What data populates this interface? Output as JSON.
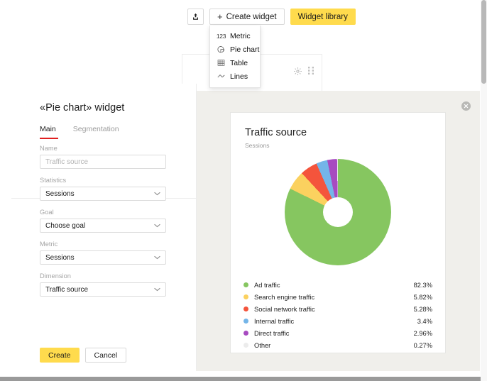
{
  "toolbar": {
    "export_icon": "upload-icon",
    "create_widget_label": "Create widget",
    "create_widget_plus": "+",
    "widget_library_label": "Widget library",
    "accent_yellow": "#ffdb4d"
  },
  "dropdown": {
    "items": [
      {
        "label": "Metric",
        "icon": "number-123-icon",
        "glyph": "123"
      },
      {
        "label": "Pie chart",
        "icon": "pie-chart-icon",
        "glyph": ""
      },
      {
        "label": "Table",
        "icon": "table-grid-icon",
        "glyph": ""
      },
      {
        "label": "Lines",
        "icon": "line-wave-icon",
        "glyph": ""
      }
    ]
  },
  "background_card": {
    "gear_icon": "gear-icon",
    "drag_icon": "drag-handle-icon"
  },
  "overlay": {
    "close_icon": "close-circle-icon",
    "background_color": "#f0efeb"
  },
  "panel": {
    "title": "«Pie chart» widget",
    "tabs": [
      {
        "label": "Main",
        "active": true
      },
      {
        "label": "Segmentation",
        "active": false
      }
    ],
    "active_tab_underline_color": "#e02020",
    "fields": [
      {
        "label": "Name",
        "type": "input",
        "value": "",
        "placeholder": "Traffic source"
      },
      {
        "label": "Statistics",
        "type": "select",
        "value": "Sessions"
      },
      {
        "label": "Goal",
        "type": "select",
        "value": "Choose goal"
      },
      {
        "label": "Metric",
        "type": "select",
        "value": "Sessions"
      },
      {
        "label": "Dimension",
        "type": "select",
        "value": "Traffic source"
      }
    ],
    "create_label": "Create",
    "cancel_label": "Cancel"
  },
  "chart_data": {
    "type": "pie",
    "title": "Traffic source",
    "subtitle": "Sessions",
    "xlabel": "",
    "ylabel": "",
    "legend_position": "bottom",
    "donut": true,
    "start_angle_deg": 0,
    "direction": "clockwise",
    "categories": [
      "Ad traffic",
      "Search engine traffic",
      "Social network traffic",
      "Internal traffic",
      "Direct traffic",
      "Other"
    ],
    "values": [
      82.3,
      5.82,
      5.28,
      3.4,
      2.96,
      0.27
    ],
    "value_labels": [
      "82.3%",
      "5.82%",
      "5.28%",
      "3.4%",
      "2.96%",
      "0.27%"
    ],
    "colors": [
      "#86c660",
      "#fbd15f",
      "#f4543c",
      "#74b5e8",
      "#a74bc0",
      "#ececec"
    ],
    "unit": "%"
  }
}
